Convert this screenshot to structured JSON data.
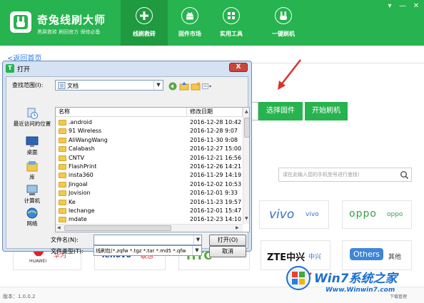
{
  "header": {
    "app_title": "奇兔线刷大师",
    "app_subtitle": "黑屏救砖 刷回官方 保修必备",
    "tabs": [
      {
        "label": "线刷救砖",
        "active": true,
        "icon": "plus-icon"
      },
      {
        "label": "固件市场",
        "active": false,
        "icon": "android-icon"
      },
      {
        "label": "实用工具",
        "active": false,
        "icon": "grid-icon"
      },
      {
        "label": "一键刷机",
        "active": false,
        "icon": "rabbit-icon"
      }
    ],
    "window_controls": [
      "▾",
      "—",
      "✕"
    ]
  },
  "main": {
    "back_link": "<返回首页",
    "select_firmware": "选择固件",
    "start_flash": "开始刷机",
    "search_placeholder": "请在此输入您的手机型号进行查找!",
    "brands": [
      {
        "logo": "HUAWEI",
        "name": "华为"
      },
      {
        "logo": "lenovo",
        "name": "联想"
      },
      {
        "logo": "HTC",
        "name": "HTC"
      },
      {
        "logo": "ZTE中兴",
        "name": "中兴"
      },
      {
        "logo": "Others",
        "name": "其他"
      },
      {
        "logo": "vivo",
        "name": "vivo"
      },
      {
        "logo": "oppo",
        "name": "oppo"
      }
    ]
  },
  "footer": {
    "version": "版本：1.0.0.2",
    "watermark_title": "Win7系统之家",
    "watermark_url": "Www.Winwin7.com",
    "download_label": "下载管理"
  },
  "dialog": {
    "title": "打开",
    "close_label": "X",
    "lookin_label": "查找范围(I):",
    "lookin_value": "文档",
    "places": [
      {
        "label": "最近访问的位置",
        "icon": "recent-icon"
      },
      {
        "label": "桌面",
        "icon": "desktop-icon"
      },
      {
        "label": "库",
        "icon": "library-icon"
      },
      {
        "label": "计算机",
        "icon": "computer-icon"
      },
      {
        "label": "网络",
        "icon": "network-icon"
      }
    ],
    "columns": {
      "name": "名称",
      "date": "修改日期"
    },
    "files": [
      {
        "name": ".android",
        "date": "2016-12-28 10:42"
      },
      {
        "name": "91 Wireless",
        "date": "2016-12-28 9:07"
      },
      {
        "name": "AliWangWang",
        "date": "2016-11-30 9:08"
      },
      {
        "name": "Calabash",
        "date": "2016-12-27 15:00"
      },
      {
        "name": "CNTV",
        "date": "2016-12-21 16:56"
      },
      {
        "name": "FlashPrint",
        "date": "2016-12-26 14:21"
      },
      {
        "name": "insta360",
        "date": "2016-11-29 14:19"
      },
      {
        "name": "Jingoal",
        "date": "2016-12-02 10:53"
      },
      {
        "name": "Jovision",
        "date": "2016-12-01 9:33"
      },
      {
        "name": "Ke",
        "date": "2016-11-23 19:57"
      },
      {
        "name": "lechange",
        "date": "2016-12-01 15:47"
      },
      {
        "name": "mdate",
        "date": "2016-12-23 14:10"
      }
    ],
    "filename_label": "文件名(N):",
    "filename_value": "",
    "filetype_label": "文件类型(T):",
    "filetype_value": "线刷包(*.zqfw *.tgz *.tar *.md5 *.qfw",
    "open_button": "打开(O)",
    "cancel_button": "取消"
  },
  "colors": {
    "brand_green": "#27b34f",
    "active_tab": "#1f9a40",
    "link_blue": "#2a7de1",
    "arrow_red": "#d9322b"
  }
}
